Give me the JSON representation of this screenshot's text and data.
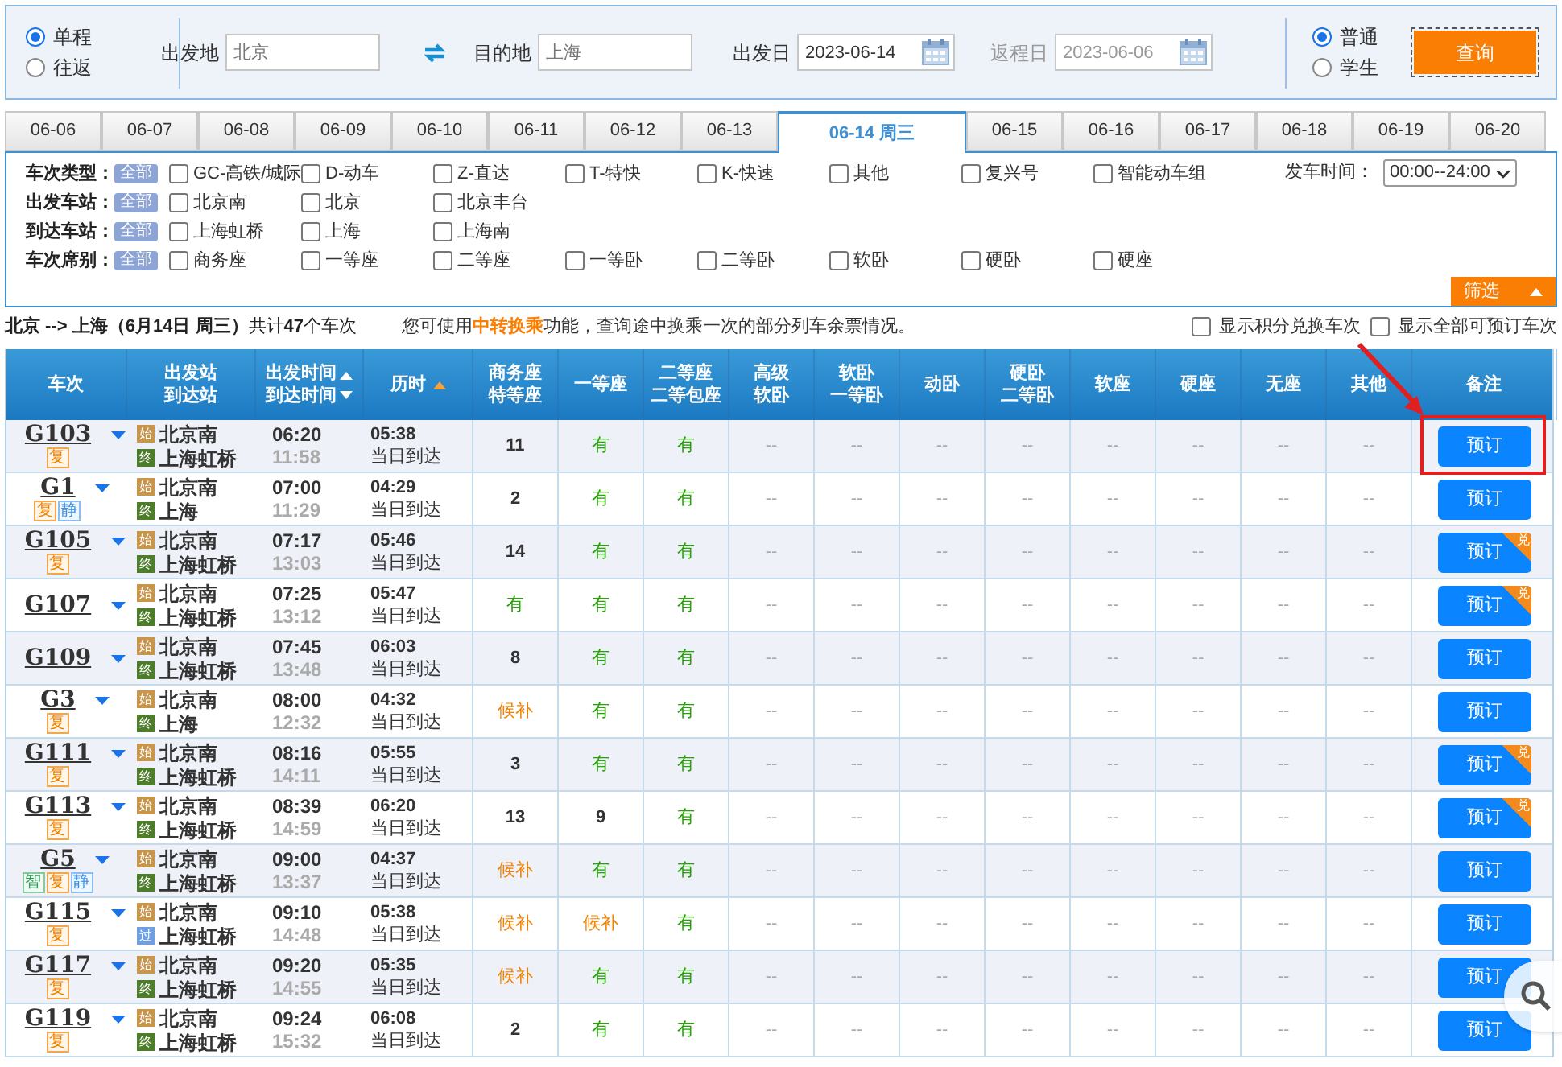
{
  "search": {
    "trip_types": [
      {
        "label": "单程",
        "selected": true
      },
      {
        "label": "往返",
        "selected": false
      }
    ],
    "from": {
      "label": "出发地",
      "value": "北京"
    },
    "to": {
      "label": "目的地",
      "value": "上海"
    },
    "depart_date": {
      "label": "出发日",
      "value": "2023-06-14",
      "disabled": false
    },
    "return_date": {
      "label": "返程日",
      "value": "2023-06-06",
      "disabled": true
    },
    "passenger_types": [
      {
        "label": "普通",
        "selected": true
      },
      {
        "label": "学生",
        "selected": false
      }
    ],
    "query_button": "查询"
  },
  "date_tabs": [
    {
      "label": "06-06",
      "selected": false
    },
    {
      "label": "06-07",
      "selected": false
    },
    {
      "label": "06-08",
      "selected": false
    },
    {
      "label": "06-09",
      "selected": false
    },
    {
      "label": "06-10",
      "selected": false
    },
    {
      "label": "06-11",
      "selected": false
    },
    {
      "label": "06-12",
      "selected": false
    },
    {
      "label": "06-13",
      "selected": false
    },
    {
      "label": "06-14 周三",
      "selected": true
    },
    {
      "label": "06-15",
      "selected": false
    },
    {
      "label": "06-16",
      "selected": false
    },
    {
      "label": "06-17",
      "selected": false
    },
    {
      "label": "06-18",
      "selected": false
    },
    {
      "label": "06-19",
      "selected": false
    },
    {
      "label": "06-20",
      "selected": false
    }
  ],
  "filters": [
    {
      "label": "车次类型：",
      "all": "全部",
      "options": [
        {
          "label": "GC-高铁/城际",
          "checked": false
        },
        {
          "label": "D-动车",
          "checked": false
        },
        {
          "label": "Z-直达",
          "checked": false
        },
        {
          "label": "T-特快",
          "checked": false
        },
        {
          "label": "K-快速",
          "checked": false
        },
        {
          "label": "其他",
          "checked": false
        },
        {
          "label": "复兴号",
          "checked": false
        },
        {
          "label": "智能动车组",
          "checked": false
        }
      ]
    },
    {
      "label": "出发车站：",
      "all": "全部",
      "options": [
        {
          "label": "北京南",
          "checked": false
        },
        {
          "label": "北京",
          "checked": false
        },
        {
          "label": "北京丰台",
          "checked": false
        }
      ]
    },
    {
      "label": "到达车站：",
      "all": "全部",
      "options": [
        {
          "label": "上海虹桥",
          "checked": false
        },
        {
          "label": "上海",
          "checked": false
        },
        {
          "label": "上海南",
          "checked": false
        }
      ]
    },
    {
      "label": "车次席别：",
      "all": "全部",
      "options": [
        {
          "label": "商务座",
          "checked": false
        },
        {
          "label": "一等座",
          "checked": false
        },
        {
          "label": "二等座",
          "checked": false
        },
        {
          "label": "一等卧",
          "checked": false
        },
        {
          "label": "二等卧",
          "checked": false
        },
        {
          "label": "软卧",
          "checked": false
        },
        {
          "label": "硬卧",
          "checked": false
        },
        {
          "label": "硬座",
          "checked": false
        }
      ]
    }
  ],
  "departure_time": {
    "label": "发车时间：",
    "value": "00:00--24:00"
  },
  "filter_button": "筛选",
  "summary": "**北京 --> 上海（6月14日  周三）**共计**47**个车次",
  "transfer_note": {
    "before": "您可使用",
    "link": "中转换乘",
    "after": "功能，查询途中换乘一次的部分列车余票情况。"
  },
  "display_options": [
    {
      "label": "显示积分兑换车次",
      "checked": false
    },
    {
      "label": "显示全部可预订车次",
      "checked": false
    }
  ],
  "table": {
    "columns": [
      {
        "lines": [
          "车次"
        ]
      },
      {
        "lines": [
          "出发站",
          "到达站"
        ]
      },
      {
        "lines": [
          "出发时间",
          "到达时间"
        ],
        "sort_up": true,
        "sort_down": true
      },
      {
        "lines": [
          "历时"
        ],
        "sort_up": true,
        "sort_down": false
      },
      {
        "lines": [
          "商务座",
          "特等座"
        ]
      },
      {
        "lines": [
          "一等座"
        ]
      },
      {
        "lines": [
          "二等座",
          "二等包座"
        ]
      },
      {
        "lines": [
          "高级",
          "软卧"
        ]
      },
      {
        "lines": [
          "软卧",
          "一等卧"
        ]
      },
      {
        "lines": [
          "动卧"
        ]
      },
      {
        "lines": [
          "硬卧",
          "二等卧"
        ]
      },
      {
        "lines": [
          "软座"
        ]
      },
      {
        "lines": [
          "硬座"
        ]
      },
      {
        "lines": [
          "无座"
        ]
      },
      {
        "lines": [
          "其他"
        ]
      },
      {
        "lines": [
          "备注"
        ]
      }
    ],
    "rows": [
      {
        "train": "G103",
        "tags": [
          {
            "text": "复",
            "kind": "fuxing"
          }
        ],
        "from": {
          "mark": "始",
          "kind": "start",
          "name": "北京南"
        },
        "to": {
          "mark": "终",
          "kind": "end",
          "name": "上海虹桥"
        },
        "depart": "06:20",
        "arrive": "11:58",
        "duration": "05:38",
        "arrival_day": "当日到达",
        "seats": [
          {
            "text": "11",
            "kind": "count"
          },
          {
            "text": "有",
            "kind": "available"
          },
          {
            "text": "有",
            "kind": "available"
          },
          {
            "text": "--",
            "kind": "none"
          },
          {
            "text": "--",
            "kind": "none"
          },
          {
            "text": "--",
            "kind": "none"
          },
          {
            "text": "--",
            "kind": "none"
          },
          {
            "text": "--",
            "kind": "none"
          },
          {
            "text": "--",
            "kind": "none"
          },
          {
            "text": "--",
            "kind": "none"
          },
          {
            "text": "--",
            "kind": "none"
          }
        ],
        "button": "预订",
        "points_badge": null,
        "highlighted": true
      },
      {
        "train": "G1",
        "tags": [
          {
            "text": "复",
            "kind": "fuxing"
          },
          {
            "text": "静",
            "kind": "quiet"
          }
        ],
        "from": {
          "mark": "始",
          "kind": "start",
          "name": "北京南"
        },
        "to": {
          "mark": "终",
          "kind": "end",
          "name": "上海"
        },
        "depart": "07:00",
        "arrive": "11:29",
        "duration": "04:29",
        "arrival_day": "当日到达",
        "seats": [
          {
            "text": "2",
            "kind": "count"
          },
          {
            "text": "有",
            "kind": "available"
          },
          {
            "text": "有",
            "kind": "available"
          },
          {
            "text": "--",
            "kind": "none"
          },
          {
            "text": "--",
            "kind": "none"
          },
          {
            "text": "--",
            "kind": "none"
          },
          {
            "text": "--",
            "kind": "none"
          },
          {
            "text": "--",
            "kind": "none"
          },
          {
            "text": "--",
            "kind": "none"
          },
          {
            "text": "--",
            "kind": "none"
          },
          {
            "text": "--",
            "kind": "none"
          }
        ],
        "button": "预订",
        "points_badge": null,
        "highlighted": false
      },
      {
        "train": "G105",
        "tags": [
          {
            "text": "复",
            "kind": "fuxing"
          }
        ],
        "from": {
          "mark": "始",
          "kind": "start",
          "name": "北京南"
        },
        "to": {
          "mark": "终",
          "kind": "end",
          "name": "上海虹桥"
        },
        "depart": "07:17",
        "arrive": "13:03",
        "duration": "05:46",
        "arrival_day": "当日到达",
        "seats": [
          {
            "text": "14",
            "kind": "count"
          },
          {
            "text": "有",
            "kind": "available"
          },
          {
            "text": "有",
            "kind": "available"
          },
          {
            "text": "--",
            "kind": "none"
          },
          {
            "text": "--",
            "kind": "none"
          },
          {
            "text": "--",
            "kind": "none"
          },
          {
            "text": "--",
            "kind": "none"
          },
          {
            "text": "--",
            "kind": "none"
          },
          {
            "text": "--",
            "kind": "none"
          },
          {
            "text": "--",
            "kind": "none"
          },
          {
            "text": "--",
            "kind": "none"
          }
        ],
        "button": "预订",
        "points_badge": "兑",
        "highlighted": false
      },
      {
        "train": "G107",
        "tags": [],
        "from": {
          "mark": "始",
          "kind": "start",
          "name": "北京南"
        },
        "to": {
          "mark": "终",
          "kind": "end",
          "name": "上海虹桥"
        },
        "depart": "07:25",
        "arrive": "13:12",
        "duration": "05:47",
        "arrival_day": "当日到达",
        "seats": [
          {
            "text": "有",
            "kind": "available"
          },
          {
            "text": "有",
            "kind": "available"
          },
          {
            "text": "有",
            "kind": "available"
          },
          {
            "text": "--",
            "kind": "none"
          },
          {
            "text": "--",
            "kind": "none"
          },
          {
            "text": "--",
            "kind": "none"
          },
          {
            "text": "--",
            "kind": "none"
          },
          {
            "text": "--",
            "kind": "none"
          },
          {
            "text": "--",
            "kind": "none"
          },
          {
            "text": "--",
            "kind": "none"
          },
          {
            "text": "--",
            "kind": "none"
          }
        ],
        "button": "预订",
        "points_badge": "兑",
        "highlighted": false
      },
      {
        "train": "G109",
        "tags": [],
        "from": {
          "mark": "始",
          "kind": "start",
          "name": "北京南"
        },
        "to": {
          "mark": "终",
          "kind": "end",
          "name": "上海虹桥"
        },
        "depart": "07:45",
        "arrive": "13:48",
        "duration": "06:03",
        "arrival_day": "当日到达",
        "seats": [
          {
            "text": "8",
            "kind": "count"
          },
          {
            "text": "有",
            "kind": "available"
          },
          {
            "text": "有",
            "kind": "available"
          },
          {
            "text": "--",
            "kind": "none"
          },
          {
            "text": "--",
            "kind": "none"
          },
          {
            "text": "--",
            "kind": "none"
          },
          {
            "text": "--",
            "kind": "none"
          },
          {
            "text": "--",
            "kind": "none"
          },
          {
            "text": "--",
            "kind": "none"
          },
          {
            "text": "--",
            "kind": "none"
          },
          {
            "text": "--",
            "kind": "none"
          }
        ],
        "button": "预订",
        "points_badge": null,
        "highlighted": false
      },
      {
        "train": "G3",
        "tags": [
          {
            "text": "复",
            "kind": "fuxing"
          }
        ],
        "from": {
          "mark": "始",
          "kind": "start",
          "name": "北京南"
        },
        "to": {
          "mark": "终",
          "kind": "end",
          "name": "上海"
        },
        "depart": "08:00",
        "arrive": "12:32",
        "duration": "04:32",
        "arrival_day": "当日到达",
        "seats": [
          {
            "text": "候补",
            "kind": "waitlist"
          },
          {
            "text": "有",
            "kind": "available"
          },
          {
            "text": "有",
            "kind": "available"
          },
          {
            "text": "--",
            "kind": "none"
          },
          {
            "text": "--",
            "kind": "none"
          },
          {
            "text": "--",
            "kind": "none"
          },
          {
            "text": "--",
            "kind": "none"
          },
          {
            "text": "--",
            "kind": "none"
          },
          {
            "text": "--",
            "kind": "none"
          },
          {
            "text": "--",
            "kind": "none"
          },
          {
            "text": "--",
            "kind": "none"
          }
        ],
        "button": "预订",
        "points_badge": null,
        "highlighted": false
      },
      {
        "train": "G111",
        "tags": [
          {
            "text": "复",
            "kind": "fuxing"
          }
        ],
        "from": {
          "mark": "始",
          "kind": "start",
          "name": "北京南"
        },
        "to": {
          "mark": "终",
          "kind": "end",
          "name": "上海虹桥"
        },
        "depart": "08:16",
        "arrive": "14:11",
        "duration": "05:55",
        "arrival_day": "当日到达",
        "seats": [
          {
            "text": "3",
            "kind": "count"
          },
          {
            "text": "有",
            "kind": "available"
          },
          {
            "text": "有",
            "kind": "available"
          },
          {
            "text": "--",
            "kind": "none"
          },
          {
            "text": "--",
            "kind": "none"
          },
          {
            "text": "--",
            "kind": "none"
          },
          {
            "text": "--",
            "kind": "none"
          },
          {
            "text": "--",
            "kind": "none"
          },
          {
            "text": "--",
            "kind": "none"
          },
          {
            "text": "--",
            "kind": "none"
          },
          {
            "text": "--",
            "kind": "none"
          }
        ],
        "button": "预订",
        "points_badge": "兑",
        "highlighted": false
      },
      {
        "train": "G113",
        "tags": [
          {
            "text": "复",
            "kind": "fuxing"
          }
        ],
        "from": {
          "mark": "始",
          "kind": "start",
          "name": "北京南"
        },
        "to": {
          "mark": "终",
          "kind": "end",
          "name": "上海虹桥"
        },
        "depart": "08:39",
        "arrive": "14:59",
        "duration": "06:20",
        "arrival_day": "当日到达",
        "seats": [
          {
            "text": "13",
            "kind": "count"
          },
          {
            "text": "9",
            "kind": "count"
          },
          {
            "text": "有",
            "kind": "available"
          },
          {
            "text": "--",
            "kind": "none"
          },
          {
            "text": "--",
            "kind": "none"
          },
          {
            "text": "--",
            "kind": "none"
          },
          {
            "text": "--",
            "kind": "none"
          },
          {
            "text": "--",
            "kind": "none"
          },
          {
            "text": "--",
            "kind": "none"
          },
          {
            "text": "--",
            "kind": "none"
          },
          {
            "text": "--",
            "kind": "none"
          }
        ],
        "button": "预订",
        "points_badge": "兑",
        "highlighted": false
      },
      {
        "train": "G5",
        "tags": [
          {
            "text": "智",
            "kind": "smart"
          },
          {
            "text": "复",
            "kind": "fuxing"
          },
          {
            "text": "静",
            "kind": "quiet"
          }
        ],
        "from": {
          "mark": "始",
          "kind": "start",
          "name": "北京南"
        },
        "to": {
          "mark": "终",
          "kind": "end",
          "name": "上海虹桥"
        },
        "depart": "09:00",
        "arrive": "13:37",
        "duration": "04:37",
        "arrival_day": "当日到达",
        "seats": [
          {
            "text": "候补",
            "kind": "waitlist"
          },
          {
            "text": "有",
            "kind": "available"
          },
          {
            "text": "有",
            "kind": "available"
          },
          {
            "text": "--",
            "kind": "none"
          },
          {
            "text": "--",
            "kind": "none"
          },
          {
            "text": "--",
            "kind": "none"
          },
          {
            "text": "--",
            "kind": "none"
          },
          {
            "text": "--",
            "kind": "none"
          },
          {
            "text": "--",
            "kind": "none"
          },
          {
            "text": "--",
            "kind": "none"
          },
          {
            "text": "--",
            "kind": "none"
          }
        ],
        "button": "预订",
        "points_badge": null,
        "highlighted": false
      },
      {
        "train": "G115",
        "tags": [
          {
            "text": "复",
            "kind": "fuxing"
          }
        ],
        "from": {
          "mark": "始",
          "kind": "start",
          "name": "北京南"
        },
        "to": {
          "mark": "过",
          "kind": "pass",
          "name": "上海虹桥"
        },
        "depart": "09:10",
        "arrive": "14:48",
        "duration": "05:38",
        "arrival_day": "当日到达",
        "seats": [
          {
            "text": "候补",
            "kind": "waitlist"
          },
          {
            "text": "候补",
            "kind": "waitlist"
          },
          {
            "text": "有",
            "kind": "available"
          },
          {
            "text": "--",
            "kind": "none"
          },
          {
            "text": "--",
            "kind": "none"
          },
          {
            "text": "--",
            "kind": "none"
          },
          {
            "text": "--",
            "kind": "none"
          },
          {
            "text": "--",
            "kind": "none"
          },
          {
            "text": "--",
            "kind": "none"
          },
          {
            "text": "--",
            "kind": "none"
          },
          {
            "text": "--",
            "kind": "none"
          }
        ],
        "button": "预订",
        "points_badge": null,
        "highlighted": false
      },
      {
        "train": "G117",
        "tags": [
          {
            "text": "复",
            "kind": "fuxing"
          }
        ],
        "from": {
          "mark": "始",
          "kind": "start",
          "name": "北京南"
        },
        "to": {
          "mark": "终",
          "kind": "end",
          "name": "上海虹桥"
        },
        "depart": "09:20",
        "arrive": "14:55",
        "duration": "05:35",
        "arrival_day": "当日到达",
        "seats": [
          {
            "text": "候补",
            "kind": "waitlist"
          },
          {
            "text": "有",
            "kind": "available"
          },
          {
            "text": "有",
            "kind": "available"
          },
          {
            "text": "--",
            "kind": "none"
          },
          {
            "text": "--",
            "kind": "none"
          },
          {
            "text": "--",
            "kind": "none"
          },
          {
            "text": "--",
            "kind": "none"
          },
          {
            "text": "--",
            "kind": "none"
          },
          {
            "text": "--",
            "kind": "none"
          },
          {
            "text": "--",
            "kind": "none"
          },
          {
            "text": "--",
            "kind": "none"
          }
        ],
        "button": "预订",
        "points_badge": null,
        "highlighted": false
      },
      {
        "train": "G119",
        "tags": [
          {
            "text": "复",
            "kind": "fuxing"
          }
        ],
        "from": {
          "mark": "始",
          "kind": "start",
          "name": "北京南"
        },
        "to": {
          "mark": "终",
          "kind": "end",
          "name": "上海虹桥"
        },
        "depart": "09:24",
        "arrive": "15:32",
        "duration": "06:08",
        "arrival_day": "当日到达",
        "seats": [
          {
            "text": "2",
            "kind": "count"
          },
          {
            "text": "有",
            "kind": "available"
          },
          {
            "text": "有",
            "kind": "available"
          },
          {
            "text": "--",
            "kind": "none"
          },
          {
            "text": "--",
            "kind": "none"
          },
          {
            "text": "--",
            "kind": "none"
          },
          {
            "text": "--",
            "kind": "none"
          },
          {
            "text": "--",
            "kind": "none"
          },
          {
            "text": "--",
            "kind": "none"
          },
          {
            "text": "--",
            "kind": "none"
          },
          {
            "text": "--",
            "kind": "none"
          }
        ],
        "button": "预订",
        "points_badge": null,
        "highlighted": false
      }
    ]
  }
}
